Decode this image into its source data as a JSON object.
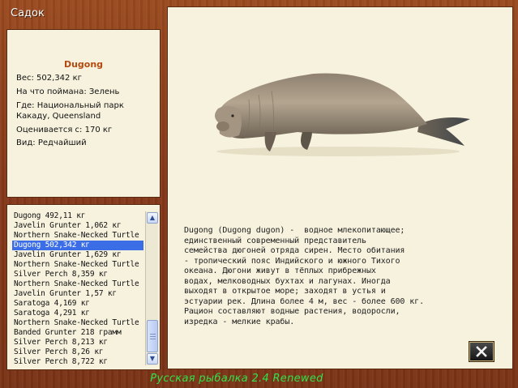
{
  "window": {
    "title": "Садок"
  },
  "info": {
    "name": "Dugong",
    "weight": "Вес: 502,342 кг",
    "bait": "На что поймана: Зелень",
    "location": "Где: Национальный парк Какаду, Queensland",
    "value": "Оценивается с: 170 кг",
    "species_type": "Вид: Редчайший"
  },
  "catch_list": {
    "selected_index": 3,
    "items": [
      "Dugong 492,11 кг",
      "Javelin Grunter 1,062 кг",
      "Northern Snake-Necked Turtle",
      "Dugong 502,342 кг",
      "Javelin Grunter 1,629 кг",
      "Northern Snake-Necked Turtle",
      "Silver Perch 8,359 кг",
      "Northern Snake-Necked Turtle",
      "Javelin Grunter 1,57 кг",
      "Saratoga 4,169 кг",
      "Saratoga 4,291 кг",
      "Northern Snake-Necked Turtle",
      "Banded Grunter 218 грамм",
      "Silver Perch 8,213 кг",
      "Silver Perch 8,26 кг",
      "Silver Perch 8,722 кг"
    ]
  },
  "description": {
    "text": "Dugong (Dugong dugon) -  водное млекопитающее;\nединственный современный представитель\nсемейства дюгоней отряда сирен. Место обитания\n- тропический пояс Индийского и южного Тихого\nокеана. Дюгони живут в тёплых прибрежных\nводах, мелководных бухтах и лагунах. Иногда\nвыходят в открытое море; заходят в устья и\nэстуарии рек. Длина более 4 м, вес - более 600 кг.\nРацион составляют водные растения, водоросли,\nизредка - мелкие крабы."
  },
  "footer": {
    "text": "Русская рыбалка  2.4  Renewed"
  },
  "icons": {
    "close": "close-x-icon",
    "scroll_up": "chevron-up-icon",
    "scroll_down": "chevron-down-icon"
  },
  "colors": {
    "wood": "#8a3d17",
    "panel": "#f7f2de",
    "selection": "#3b6ee6",
    "fish_name": "#b34a10",
    "footer": "#2fe24a"
  }
}
